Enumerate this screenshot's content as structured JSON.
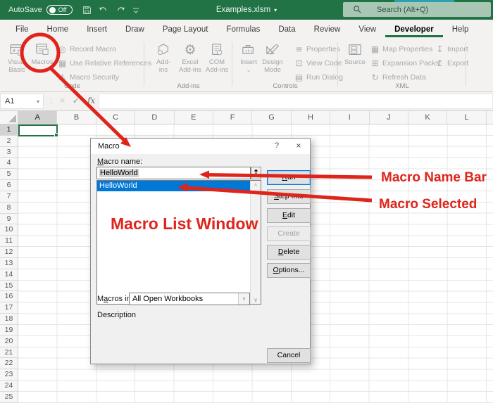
{
  "colors": {
    "excel_green": "#217346",
    "selection_blue": "#0078d7",
    "annotation_red": "#df241b",
    "search_bg": "#a8c6b4"
  },
  "titlebar": {
    "autosave_label": "AutoSave",
    "autosave_state": "Off",
    "document_title": "Examples.xlsm",
    "search_placeholder": "Search (Alt+Q)"
  },
  "ribbon": {
    "active_tab": "Developer",
    "tabs": [
      {
        "label": "File"
      },
      {
        "label": "Home"
      },
      {
        "label": "Insert"
      },
      {
        "label": "Draw"
      },
      {
        "label": "Page Layout"
      },
      {
        "label": "Formulas"
      },
      {
        "label": "Data"
      },
      {
        "label": "Review"
      },
      {
        "label": "View"
      },
      {
        "label": "Developer"
      },
      {
        "label": "Help"
      }
    ],
    "code_group": {
      "name": "Code",
      "visual_basic_line1": "Visual",
      "visual_basic_line2": "Basic",
      "macros_label": "Macros",
      "record_macro": "Record Macro",
      "use_relative_references": "Use Relative References",
      "macro_security": "Macro Security"
    },
    "addins_group": {
      "name": "Add-ins",
      "addins_line1": "Add-",
      "addins_line2": "ins",
      "excel_addins_line1": "Excel",
      "excel_addins_line2": "Add-ins",
      "com_addins_line1": "COM",
      "com_addins_line2": "Add-ins"
    },
    "controls_group": {
      "name": "Controls",
      "insert_label": "Insert",
      "design_mode_line1": "Design",
      "design_mode_line2": "Mode",
      "properties": "Properties",
      "view_code": "View Code",
      "run_dialog": "Run Dialog"
    },
    "xml_group": {
      "name": "XML",
      "source_label": "Source",
      "map_properties": "Map Properties",
      "expansion_packs": "Expansion Packs",
      "refresh_data": "Refresh Data",
      "import_label": "Import",
      "export_label": "Export"
    }
  },
  "formula_bar": {
    "name_box_value": "A1",
    "fx_label": "fx",
    "formula_value": ""
  },
  "grid": {
    "columns": [
      "A",
      "B",
      "C",
      "D",
      "E",
      "F",
      "G",
      "H",
      "I",
      "J",
      "K",
      "L"
    ],
    "row_count": 25,
    "selected_cell": "A1",
    "selected_column": "A",
    "selected_row": "1"
  },
  "dialog": {
    "title": "Macro",
    "help_label": "?",
    "close_label": "×",
    "macro_name_label": "Macro name:",
    "macro_name_value": "HelloWorld",
    "list_items": [
      {
        "label": "HelloWorld",
        "selected": true
      }
    ],
    "buttons": {
      "run": "Run",
      "step_into": "Step Into",
      "edit": "Edit",
      "create": "Create",
      "delete": "Delete",
      "options": "Options...",
      "cancel": "Cancel"
    },
    "macros_in_label": "Macros in:",
    "macros_in_value": "All Open Workbooks",
    "description_label": "Description"
  },
  "annotations": {
    "name_bar_label": "Macro Name Bar",
    "selected_label": "Macro Selected",
    "list_window_label": "Macro List Window"
  }
}
